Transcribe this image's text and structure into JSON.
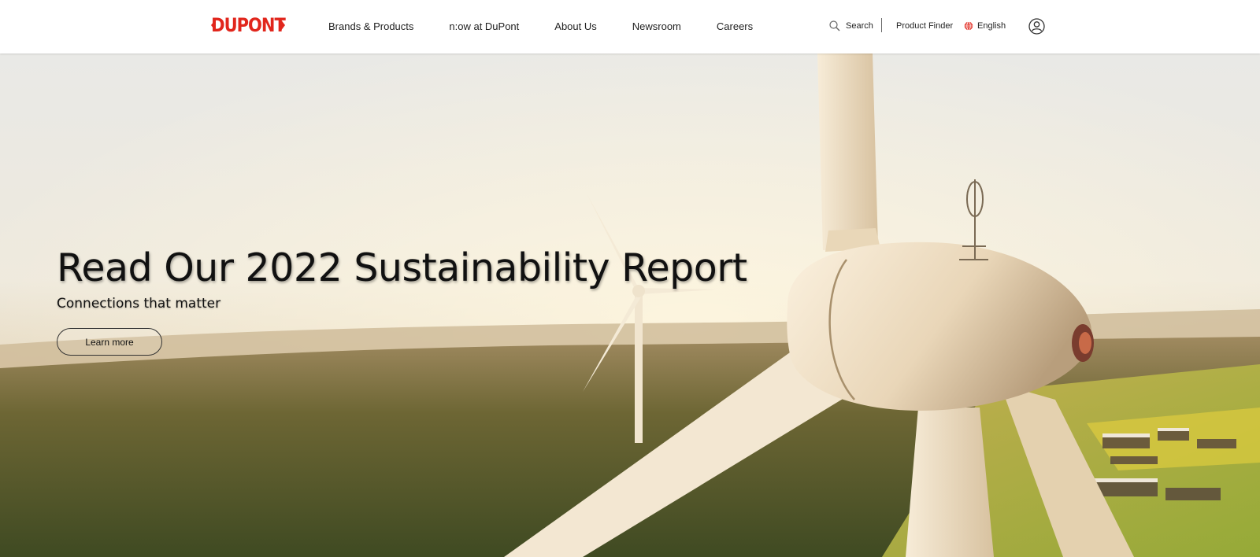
{
  "brand": {
    "logo_text": "DUPONT",
    "accent_color": "#e1261c"
  },
  "nav": {
    "items": [
      {
        "label": "Brands & Products"
      },
      {
        "label": "n:ow at DuPont"
      },
      {
        "label": "About Us"
      },
      {
        "label": "Newsroom"
      },
      {
        "label": "Careers"
      }
    ]
  },
  "utility": {
    "search_label": "Search",
    "search_icon": "search-icon",
    "product_finder_label": "Product Finder",
    "language_label": "English",
    "language_icon": "globe-icon",
    "account_icon": "user-account-icon"
  },
  "hero": {
    "title": "Read Our 2022 Sustainability Report",
    "subtitle": "Connections that matter",
    "cta_label": "Learn more"
  }
}
